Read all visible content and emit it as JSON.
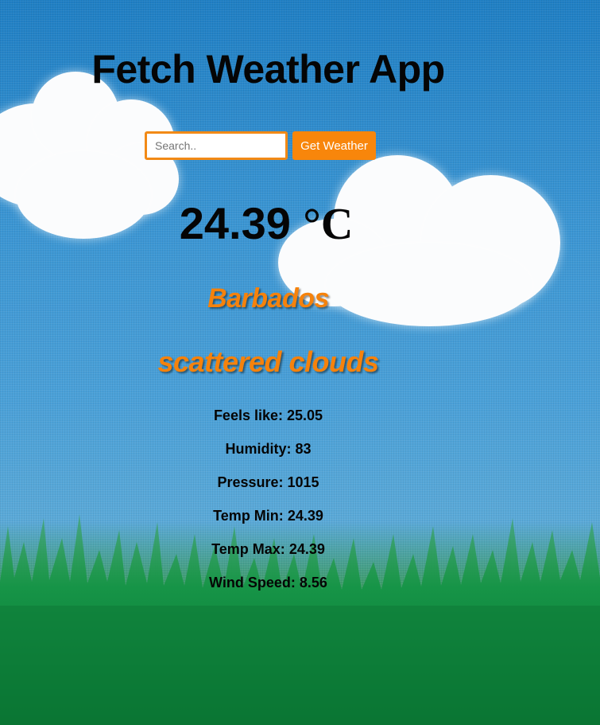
{
  "app": {
    "title": "Fetch Weather App"
  },
  "search": {
    "placeholder": "Search..",
    "button_label": "Get Weather"
  },
  "weather": {
    "temperature": "24.39",
    "unit": "°C",
    "city": "Barbados",
    "description": "scattered clouds",
    "details": [
      {
        "label": "Feels like:",
        "value": "25.05"
      },
      {
        "label": "Humidity:",
        "value": "83"
      },
      {
        "label": "Pressure:",
        "value": "1015"
      },
      {
        "label": "Temp Min:",
        "value": "24.39"
      },
      {
        "label": "Temp Max:",
        "value": "24.39"
      },
      {
        "label": "Wind Speed:",
        "value": "8.56"
      }
    ]
  },
  "colors": {
    "accent": "#f8860b",
    "sky": "#3a95d3",
    "grass": "#0f7f3c",
    "text": "#050505"
  }
}
